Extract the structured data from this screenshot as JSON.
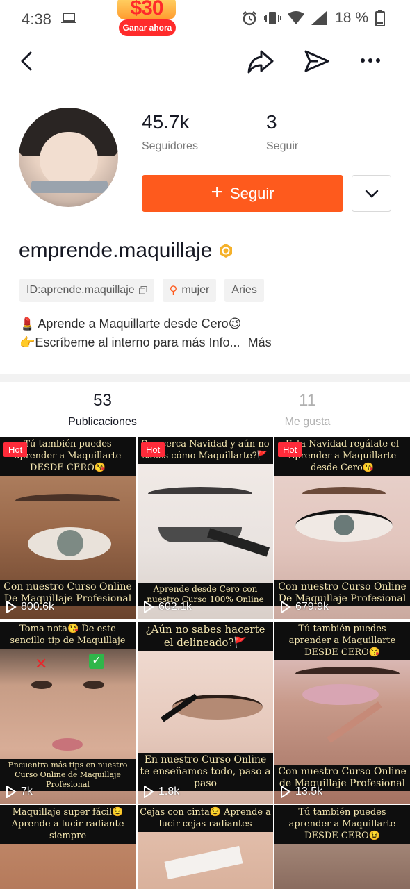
{
  "status_bar": {
    "time": "4:38",
    "battery": "18 %",
    "promo": {
      "amount": "$30",
      "button": "Ganar ahora"
    },
    "icons": [
      "laptop-icon",
      "alarm-icon",
      "vibrate-icon",
      "wifi-icon",
      "signal-icon",
      "battery-icon"
    ]
  },
  "nav": {
    "icons": [
      "back-icon",
      "share-arrow-icon",
      "send-icon",
      "more-icon"
    ]
  },
  "profile": {
    "followers_count": "45.7k",
    "followers_label": "Seguidores",
    "following_count": "3",
    "following_label": "Seguir",
    "follow_button": "Seguir",
    "username": "emprende.maquillaje",
    "tags": {
      "id": "ID:aprende.maquillaje",
      "gender": "mujer",
      "zodiac": "Aries"
    },
    "bio_line1": "💄 Aprende a Maquillarte desde Cero😉",
    "bio_line2": "👉Escríbeme al interno para más Info...",
    "bio_more": "Más",
    "accent_color": "#fe5a1d"
  },
  "tabs": [
    {
      "count": "53",
      "label": "Publicaciones"
    },
    {
      "count": "11",
      "label": "Me gusta"
    }
  ],
  "posts": [
    {
      "hot": "Hot",
      "top": "Tú también puedes aprender a Maquillarte DESDE CERO😘",
      "bottom": "Con nuestro Curso Online De Maquillaje Profesional",
      "views": "800.6k"
    },
    {
      "hot": "Hot",
      "top": "Se acerca Navidad y aún no sabes cómo Maquillarte?🚩",
      "bottom": "Aprende desde Cero con nuestro Curso 100% Online",
      "views": "602.1k"
    },
    {
      "hot": "Hot",
      "top": "Esta Navidad regálate el Aprender a Maquillarte desde Cero😘",
      "bottom": "Con nuestro Curso Online De Maquillaje Profesional",
      "views": "679.9k"
    },
    {
      "hot": "",
      "top": "Toma nota😘 De este sencillo tip de Maquillaje",
      "bottom": "Encuentra más tips en nuestro Curso Online de Maquillaje Profesional",
      "views": "7k"
    },
    {
      "hot": "",
      "top": "¿Aún no sabes hacerte el delineado?🚩",
      "bottom": "En nuestro Curso Online te enseñamos todo, paso a paso",
      "views": "1.8k"
    },
    {
      "hot": "",
      "top": "Tú también puedes aprender a Maquillarte DESDE CERO😘",
      "bottom": "Con nuestro Curso Online de Maquillaje Profesional",
      "views": "13.5k"
    },
    {
      "hot": "",
      "top": "Maquillaje super fácil😉 Aprende a lucir radiante siempre",
      "bottom": "",
      "views": ""
    },
    {
      "hot": "",
      "top": "Cejas con cinta😉 Aprende a lucir cejas radiantes",
      "bottom": "",
      "views": ""
    },
    {
      "hot": "",
      "top": "Tú también puedes aprender a Maquillarte DESDE CERO😉",
      "bottom": "",
      "views": ""
    }
  ]
}
